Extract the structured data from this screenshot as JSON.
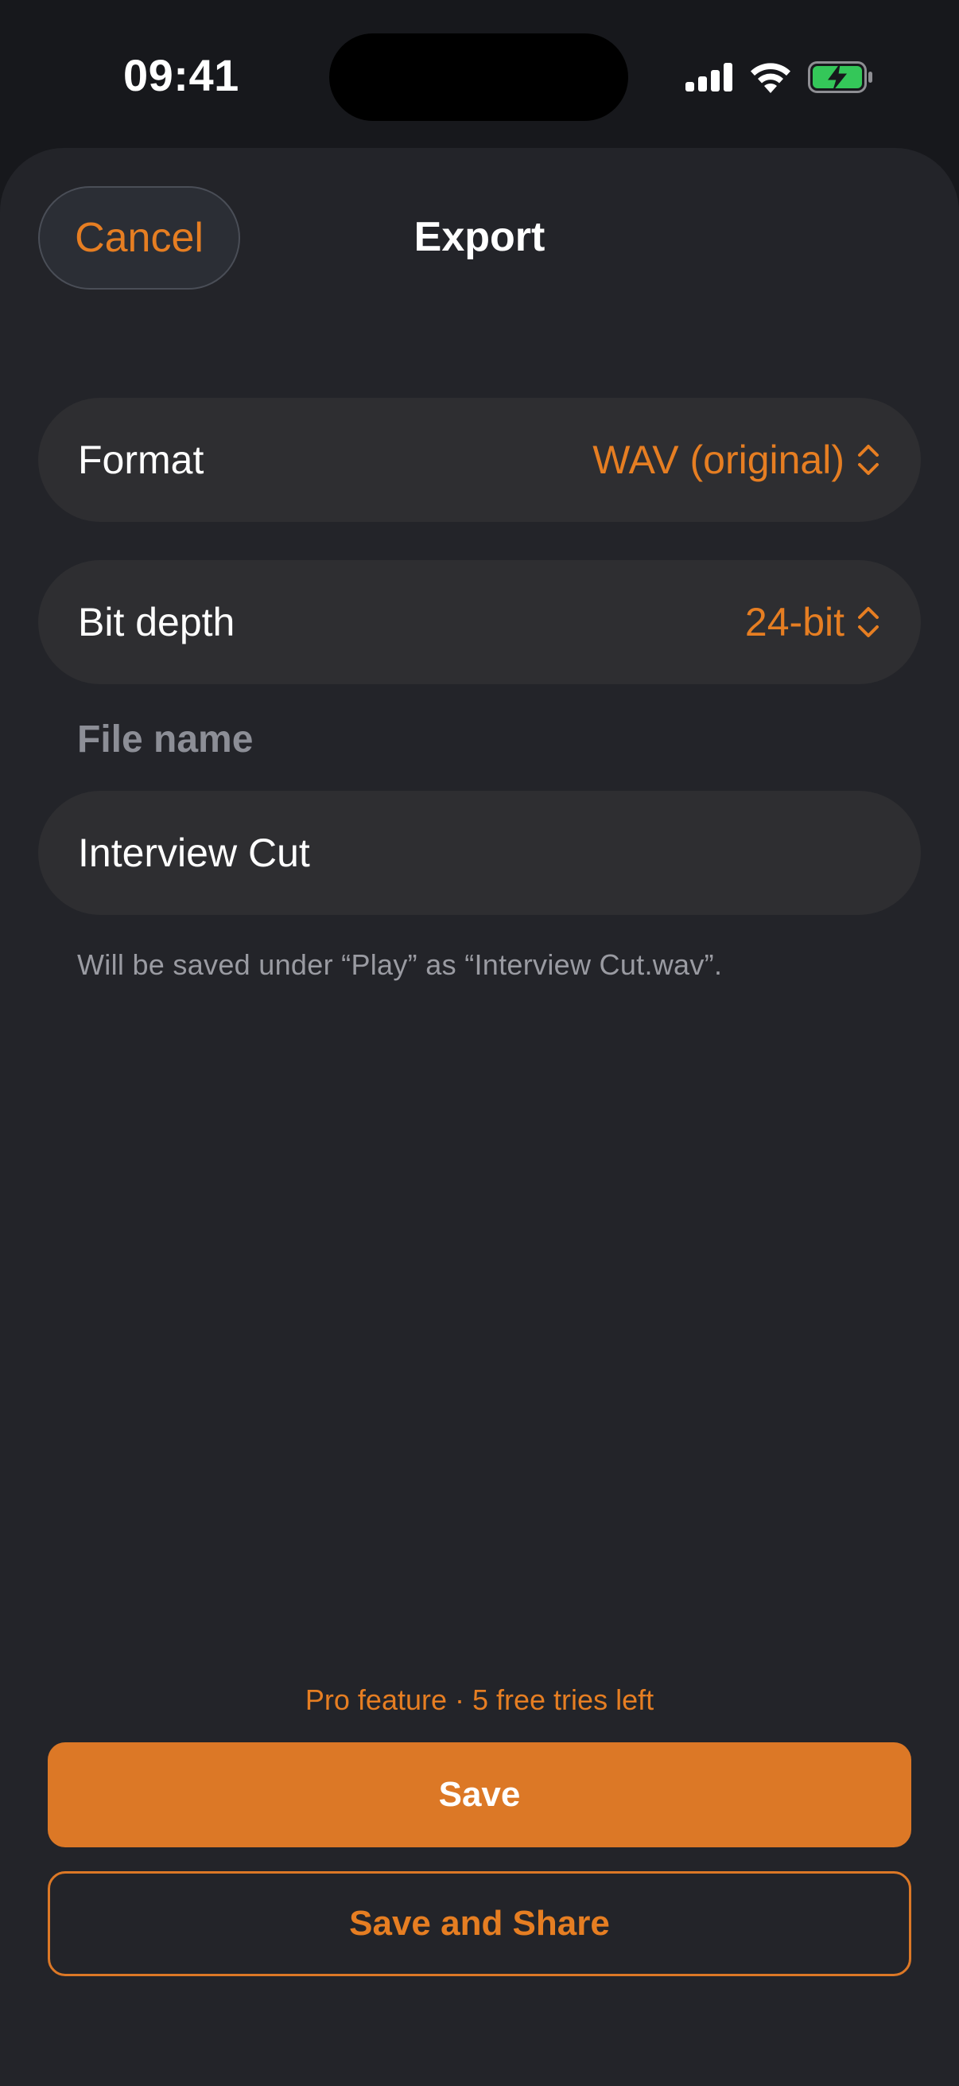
{
  "status_bar": {
    "time": "09:41",
    "icons": [
      "cellular-signal-icon",
      "wifi-icon",
      "battery-charging-icon"
    ],
    "battery_color": "#34c759"
  },
  "sheet": {
    "title": "Export",
    "cancel_label": "Cancel"
  },
  "format": {
    "label": "Format",
    "value": "WAV (original)"
  },
  "bit_depth": {
    "label": "Bit depth",
    "value": "24-bit"
  },
  "file_name": {
    "section_label": "File name",
    "value": "Interview Cut",
    "hint": "Will be saved under “Play” as “Interview Cut.wav”."
  },
  "footer": {
    "pro_note": "Pro feature · 5 free tries left",
    "save_label": "Save",
    "share_label": "Save and Share"
  },
  "colors": {
    "accent": "#e67e22",
    "button_fill": "#dc7826",
    "sheet_background": "#232429",
    "row_background": "#2e2e31"
  }
}
